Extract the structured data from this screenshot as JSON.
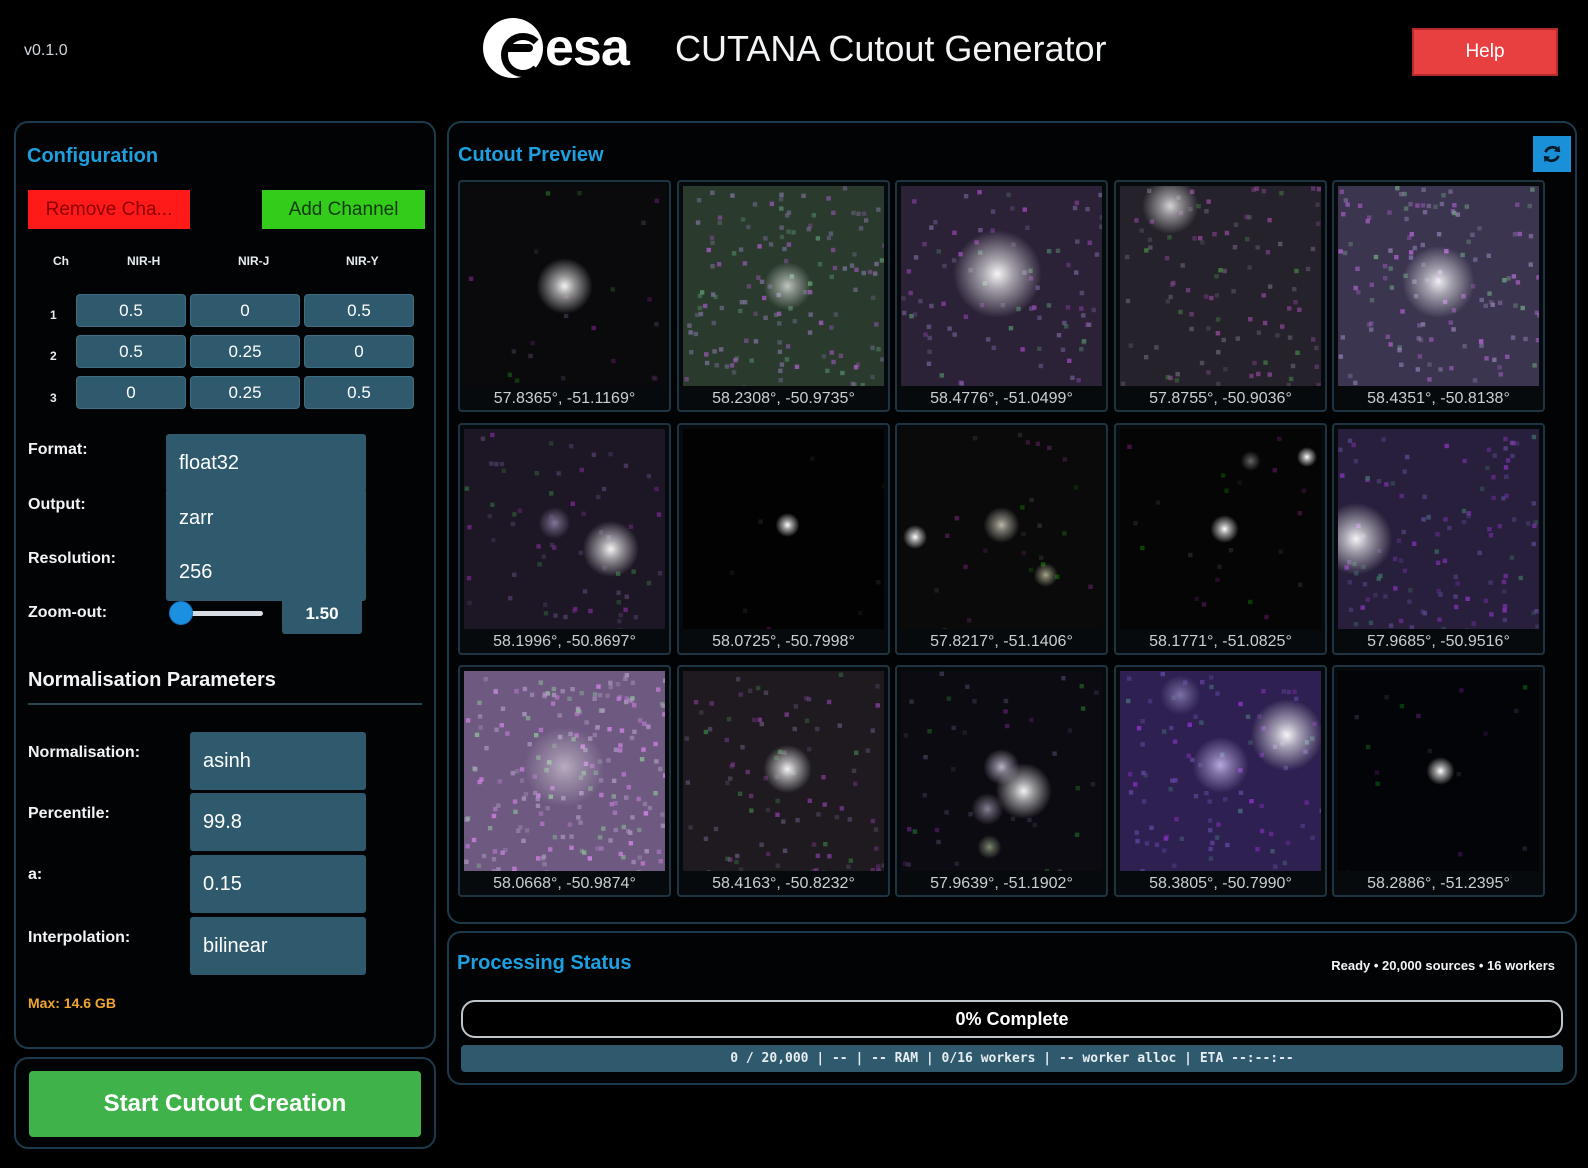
{
  "header": {
    "version": "v0.1.0",
    "logo_text": "esa",
    "title": "CUTANA Cutout Generator",
    "help_label": "Help",
    "help_color": "#e84040"
  },
  "config": {
    "title": "Configuration",
    "remove_channel_label": "Remove Cha...",
    "add_channel_label": "Add Channel",
    "matrix": {
      "col_headers": [
        "Ch",
        "NIR-H",
        "NIR-J",
        "NIR-Y"
      ],
      "rows": [
        {
          "ch": "1",
          "values": [
            "0.5",
            "0",
            "0.5"
          ]
        },
        {
          "ch": "2",
          "values": [
            "0.5",
            "0.25",
            "0"
          ]
        },
        {
          "ch": "3",
          "values": [
            "0",
            "0.25",
            "0.5"
          ]
        }
      ]
    },
    "format_label": "Format:",
    "format_value": "float32",
    "output_label": "Output:",
    "output_value": "zarr",
    "resolution_label": "Resolution:",
    "resolution_value": "256",
    "zoom_label": "Zoom-out:",
    "zoom_value": "1.50",
    "norm_title": "Normalisation Parameters",
    "normalisation_label": "Normalisation:",
    "normalisation_value": "asinh",
    "percentile_label": "Percentile:",
    "percentile_value": "99.8",
    "a_label": "a:",
    "a_value": "0.15",
    "interpolation_label": "Interpolation:",
    "interpolation_value": "bilinear",
    "max_note": "Max: 14.6 GB"
  },
  "start_label": "Start Cutout Creation",
  "preview": {
    "title": "Cutout Preview",
    "refresh_icon": "refresh-icon",
    "cutouts": [
      {
        "coord": "57.8365°, -51.1169°",
        "style": "faint"
      },
      {
        "coord": "58.2308°, -50.9735°",
        "style": "noisy"
      },
      {
        "coord": "58.4776°, -51.0499°",
        "style": "purple"
      },
      {
        "coord": "57.8755°, -50.9036°",
        "style": "purple-faint"
      },
      {
        "coord": "58.4351°, -50.8138°",
        "style": "noisy-bright"
      },
      {
        "coord": "58.1996°, -50.8697°",
        "style": "purple-pair"
      },
      {
        "coord": "58.0725°, -50.7998°",
        "style": "dark-point"
      },
      {
        "coord": "57.8217°, -51.1406°",
        "style": "dark-multi"
      },
      {
        "coord": "58.1771°, -51.0825°",
        "style": "dark-multi2"
      },
      {
        "coord": "57.9685°, -50.9516°",
        "style": "purple-edge"
      },
      {
        "coord": "58.0668°, -50.9874°",
        "style": "very-noisy"
      },
      {
        "coord": "58.4163°, -50.8232°",
        "style": "noisy-center"
      },
      {
        "coord": "57.9639°, -51.1902°",
        "style": "dark-cluster"
      },
      {
        "coord": "58.3805°, -50.7990°",
        "style": "purple-streak"
      },
      {
        "coord": "58.2886°, -51.2395°",
        "style": "star-field"
      }
    ]
  },
  "status": {
    "title": "Processing Status",
    "meta": "Ready • 20,000 sources • 16 workers",
    "progress_label": "0% Complete",
    "progress_fraction": 0,
    "stats": "0 / 20,000 | -- | -- RAM | 0/16 workers | -- worker alloc | ETA --:--:--"
  }
}
